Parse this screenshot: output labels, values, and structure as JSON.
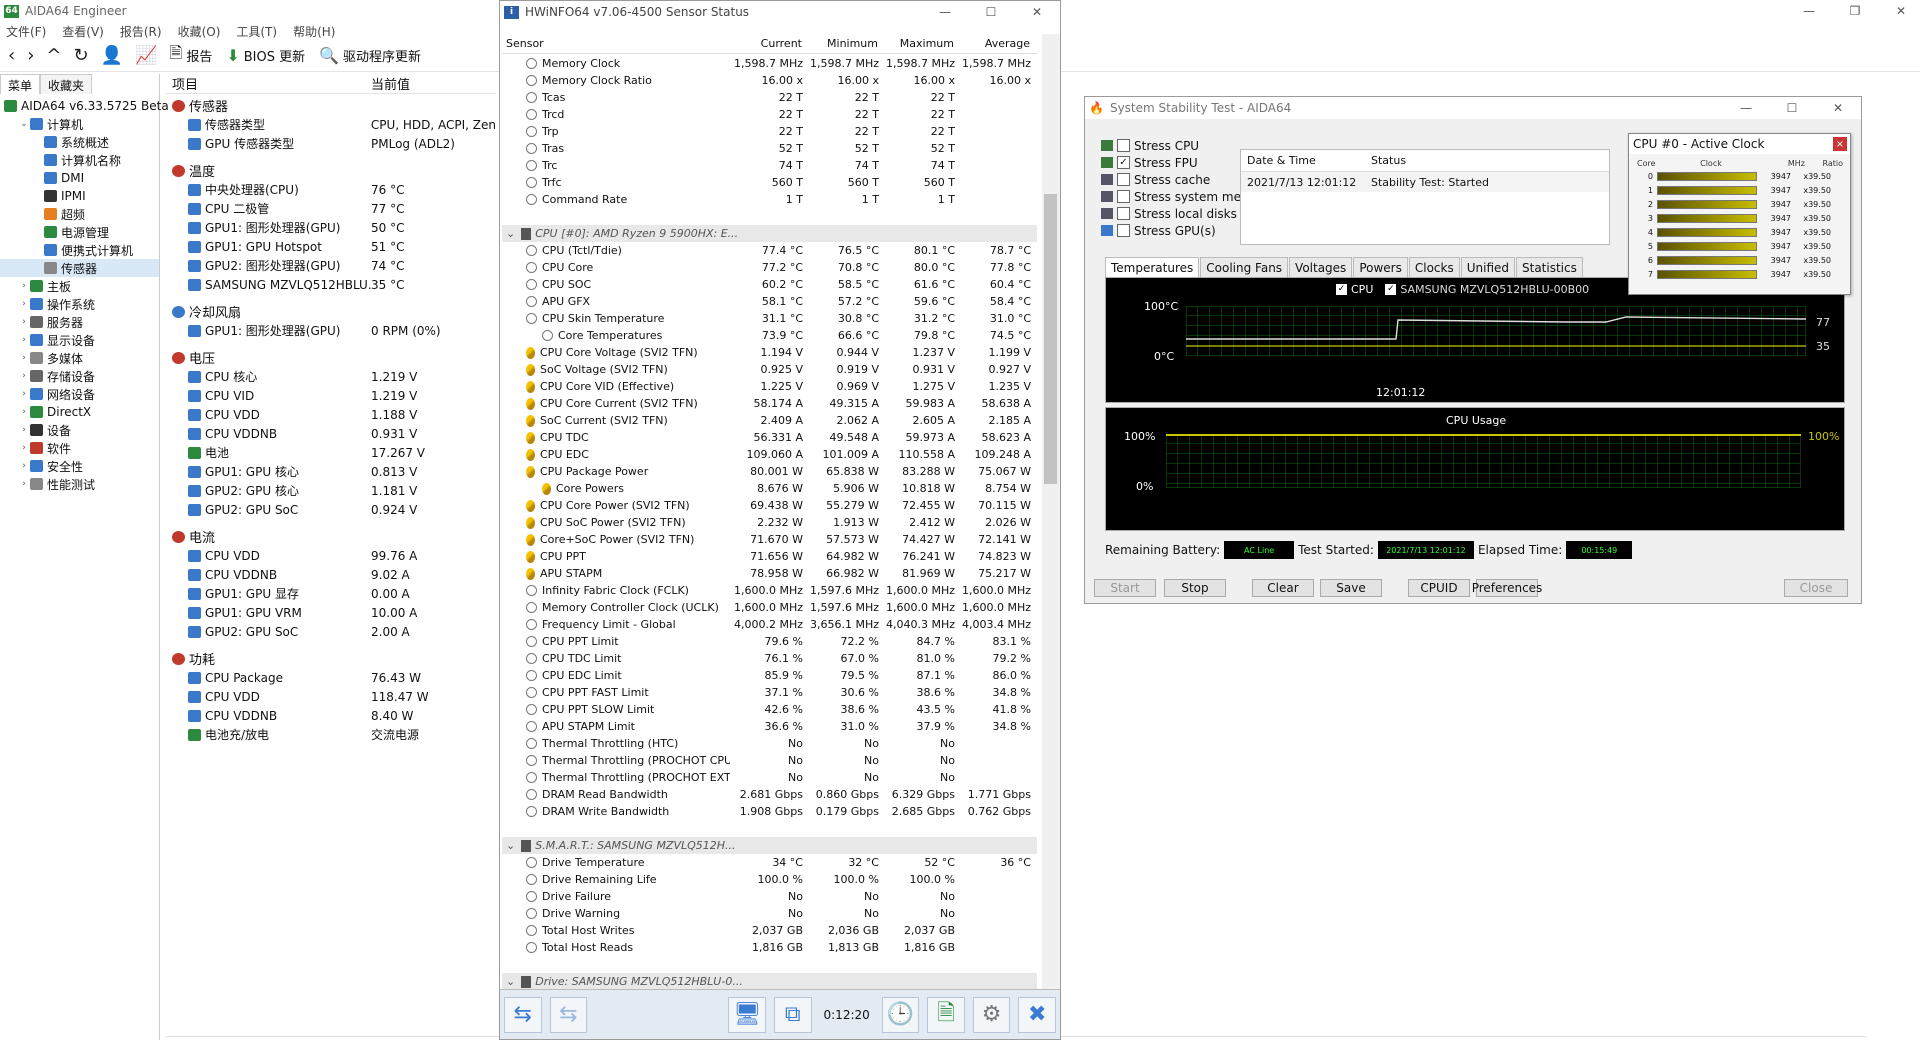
{
  "aida": {
    "title": "AIDA64 Engineer",
    "menu": [
      "文件(F)",
      "查看(V)",
      "报告(R)",
      "收藏(O)",
      "工具(T)",
      "帮助(H)"
    ],
    "toolbar": {
      "report": "报告",
      "bios": "BIOS 更新",
      "driver": "驱动程序更新"
    },
    "lefttabs": [
      "菜单",
      "收藏夹"
    ],
    "tree": [
      {
        "label": "AIDA64 v6.33.5725 Beta",
        "lvl": 0,
        "tog": "",
        "icon": "aida-icon",
        "color": "#2b8a3e"
      },
      {
        "label": "计算机",
        "lvl": 1,
        "tog": "⌄",
        "icon": "computer-icon",
        "color": "#3a78c9"
      },
      {
        "label": "系统概述",
        "lvl": 2,
        "tog": "",
        "icon": "summary-icon",
        "color": "#3a78c9"
      },
      {
        "label": "计算机名称",
        "lvl": 2,
        "tog": "",
        "icon": "name-icon",
        "color": "#3a78c9"
      },
      {
        "label": "DMI",
        "lvl": 2,
        "tog": "",
        "icon": "dmi-icon",
        "color": "#3a78c9"
      },
      {
        "label": "IPMI",
        "lvl": 2,
        "tog": "",
        "icon": "ipmi-icon",
        "color": "#333"
      },
      {
        "label": "超频",
        "lvl": 2,
        "tog": "",
        "icon": "overclock-icon",
        "color": "#e67e22"
      },
      {
        "label": "电源管理",
        "lvl": 2,
        "tog": "",
        "icon": "power-icon",
        "color": "#2b8a3e"
      },
      {
        "label": "便携式计算机",
        "lvl": 2,
        "tog": "",
        "icon": "laptop-icon",
        "color": "#3a78c9"
      },
      {
        "label": "传感器",
        "lvl": 2,
        "tog": "",
        "icon": "sensor-icon",
        "color": "#888",
        "sel": true
      },
      {
        "label": "主板",
        "lvl": 1,
        "tog": "›",
        "icon": "motherboard-icon",
        "color": "#2b8a3e"
      },
      {
        "label": "操作系统",
        "lvl": 1,
        "tog": "›",
        "icon": "os-icon",
        "color": "#3a78c9"
      },
      {
        "label": "服务器",
        "lvl": 1,
        "tog": "›",
        "icon": "server-icon",
        "color": "#666"
      },
      {
        "label": "显示设备",
        "lvl": 1,
        "tog": "›",
        "icon": "display-icon",
        "color": "#3a78c9"
      },
      {
        "label": "多媒体",
        "lvl": 1,
        "tog": "›",
        "icon": "multimedia-icon",
        "color": "#888"
      },
      {
        "label": "存储设备",
        "lvl": 1,
        "tog": "›",
        "icon": "storage-icon",
        "color": "#666"
      },
      {
        "label": "网络设备",
        "lvl": 1,
        "tog": "›",
        "icon": "network-icon",
        "color": "#3a78c9"
      },
      {
        "label": "DirectX",
        "lvl": 1,
        "tog": "›",
        "icon": "directx-icon",
        "color": "#2b8a3e"
      },
      {
        "label": "设备",
        "lvl": 1,
        "tog": "›",
        "icon": "devices-icon",
        "color": "#333"
      },
      {
        "label": "软件",
        "lvl": 1,
        "tog": "›",
        "icon": "software-icon",
        "color": "#c0392b"
      },
      {
        "label": "安全性",
        "lvl": 1,
        "tog": "›",
        "icon": "security-icon",
        "color": "#3a78c9"
      },
      {
        "label": "性能测试",
        "lvl": 1,
        "tog": "›",
        "icon": "benchmark-icon",
        "color": "#888"
      }
    ],
    "cols": [
      "项目",
      "当前值"
    ],
    "sections": [
      {
        "title": "传感器",
        "first": true,
        "rows": [
          [
            "传感器类型",
            "CPU, HDD, ACPI, Zen"
          ],
          [
            "GPU 传感器类型",
            "PMLog  (ADL2)"
          ]
        ]
      },
      {
        "title": "温度",
        "rows": [
          [
            "中央处理器(CPU)",
            "76 °C"
          ],
          [
            "CPU 二极管",
            "77 °C"
          ],
          [
            "GPU1: 图形处理器(GPU)",
            "50 °C"
          ],
          [
            "GPU1: GPU Hotspot",
            "51 °C"
          ],
          [
            "GPU2: 图形处理器(GPU)",
            "74 °C"
          ],
          [
            "SAMSUNG MZVLQ512HBLU...",
            "35 °C"
          ]
        ]
      },
      {
        "title": "冷却风扇",
        "rows": [
          [
            "GPU1: 图形处理器(GPU)",
            "0 RPM  (0%)"
          ]
        ]
      },
      {
        "title": "电压",
        "rows": [
          [
            "CPU 核心",
            "1.219 V"
          ],
          [
            "CPU VID",
            "1.219 V"
          ],
          [
            "CPU VDD",
            "1.188 V"
          ],
          [
            "CPU VDDNB",
            "0.931 V"
          ],
          [
            "电池",
            "17.267 V"
          ],
          [
            "GPU1: GPU 核心",
            "0.813 V"
          ],
          [
            "GPU2: GPU 核心",
            "1.181 V"
          ],
          [
            "GPU2: GPU SoC",
            "0.924 V"
          ]
        ]
      },
      {
        "title": "电流",
        "rows": [
          [
            "CPU VDD",
            "99.76 A"
          ],
          [
            "CPU VDDNB",
            "9.02 A"
          ],
          [
            "GPU1: GPU 显存",
            "0.00 A"
          ],
          [
            "GPU1: GPU VRM",
            "10.00 A"
          ],
          [
            "GPU2: GPU SoC",
            "2.00 A"
          ]
        ]
      },
      {
        "title": "功耗",
        "rows": [
          [
            "CPU Package",
            "76.43 W"
          ],
          [
            "CPU VDD",
            "118.47 W"
          ],
          [
            "CPU VDDNB",
            "8.40 W"
          ],
          [
            "电池充/放电",
            "交流电源"
          ]
        ]
      }
    ]
  },
  "hwinfo": {
    "title": "HWiNFO64 v7.06-4500 Sensor Status",
    "cols": [
      "Sensor",
      "Current",
      "Minimum",
      "Maximum",
      "Average"
    ],
    "time": "0:12:20",
    "rows": [
      [
        "Memory Clock",
        "1,598.7 MHz",
        "1,598.7 MHz",
        "1,598.7 MHz",
        "1,598.7 MHz"
      ],
      [
        "Memory Clock Ratio",
        "16.00 x",
        "16.00 x",
        "16.00 x",
        "16.00 x"
      ],
      [
        "Tcas",
        "22 T",
        "22 T",
        "22 T",
        ""
      ],
      [
        "Trcd",
        "22 T",
        "22 T",
        "22 T",
        ""
      ],
      [
        "Trp",
        "22 T",
        "22 T",
        "22 T",
        ""
      ],
      [
        "Tras",
        "52 T",
        "52 T",
        "52 T",
        ""
      ],
      [
        "Trc",
        "74 T",
        "74 T",
        "74 T",
        ""
      ],
      [
        "Trfc",
        "560 T",
        "560 T",
        "560 T",
        ""
      ],
      [
        "Command Rate",
        "1 T",
        "1 T",
        "1 T",
        ""
      ],
      {
        "group": "CPU [#0]: AMD Ryzen 9 5900HX: E..."
      },
      [
        "CPU (Tctl/Tdie)",
        "77.4 °C",
        "76.5 °C",
        "80.1 °C",
        "78.7 °C"
      ],
      [
        "CPU Core",
        "77.2 °C",
        "70.8 °C",
        "80.0 °C",
        "77.8 °C"
      ],
      [
        "CPU SOC",
        "60.2 °C",
        "58.5 °C",
        "61.6 °C",
        "60.4 °C"
      ],
      [
        "APU GFX",
        "58.1 °C",
        "57.2 °C",
        "59.6 °C",
        "58.4 °C"
      ],
      [
        "CPU Skin Temperature",
        "31.1 °C",
        "30.8 °C",
        "31.2 °C",
        "31.0 °C"
      ],
      [
        "Core Temperatures",
        "73.9 °C",
        "66.6 °C",
        "79.8 °C",
        "74.5 °C",
        "sub"
      ],
      [
        "CPU Core Voltage (SVI2 TFN)",
        "1.194 V",
        "0.944 V",
        "1.237 V",
        "1.199 V",
        "volt"
      ],
      [
        "SoC Voltage (SVI2 TFN)",
        "0.925 V",
        "0.919 V",
        "0.931 V",
        "0.927 V",
        "volt"
      ],
      [
        "CPU Core VID (Effective)",
        "1.225 V",
        "0.969 V",
        "1.275 V",
        "1.235 V",
        "volt"
      ],
      [
        "CPU Core Current (SVI2 TFN)",
        "58.174 A",
        "49.315 A",
        "59.983 A",
        "58.638 A",
        "volt"
      ],
      [
        "SoC Current (SVI2 TFN)",
        "2.409 A",
        "2.062 A",
        "2.605 A",
        "2.185 A",
        "volt"
      ],
      [
        "CPU TDC",
        "56.331 A",
        "49.548 A",
        "59.973 A",
        "58.623 A",
        "volt"
      ],
      [
        "CPU EDC",
        "109.060 A",
        "101.009 A",
        "110.558 A",
        "109.248 A",
        "volt"
      ],
      [
        "CPU Package Power",
        "80.001 W",
        "65.838 W",
        "83.288 W",
        "75.067 W",
        "volt"
      ],
      [
        "Core Powers",
        "8.676 W",
        "5.906 W",
        "10.818 W",
        "8.754 W",
        "subv"
      ],
      [
        "CPU Core Power (SVI2 TFN)",
        "69.438 W",
        "55.279 W",
        "72.455 W",
        "70.115 W",
        "volt"
      ],
      [
        "CPU SoC Power (SVI2 TFN)",
        "2.232 W",
        "1.913 W",
        "2.412 W",
        "2.026 W",
        "volt"
      ],
      [
        "Core+SoC Power (SVI2 TFN)",
        "71.670 W",
        "57.573 W",
        "74.427 W",
        "72.141 W",
        "volt"
      ],
      [
        "CPU PPT",
        "71.656 W",
        "64.982 W",
        "76.241 W",
        "74.823 W",
        "volt"
      ],
      [
        "APU STAPM",
        "78.958 W",
        "66.982 W",
        "81.969 W",
        "75.217 W",
        "volt"
      ],
      [
        "Infinity Fabric Clock (FCLK)",
        "1,600.0 MHz",
        "1,597.6 MHz",
        "1,600.0 MHz",
        "1,600.0 MHz"
      ],
      [
        "Memory Controller Clock (UCLK)",
        "1,600.0 MHz",
        "1,597.6 MHz",
        "1,600.0 MHz",
        "1,600.0 MHz"
      ],
      [
        "Frequency Limit - Global",
        "4,000.2 MHz",
        "3,656.1 MHz",
        "4,040.3 MHz",
        "4,003.4 MHz"
      ],
      [
        "CPU PPT Limit",
        "79.6 %",
        "72.2 %",
        "84.7 %",
        "83.1 %"
      ],
      [
        "CPU TDC Limit",
        "76.1 %",
        "67.0 %",
        "81.0 %",
        "79.2 %"
      ],
      [
        "CPU EDC Limit",
        "85.9 %",
        "79.5 %",
        "87.1 %",
        "86.0 %"
      ],
      [
        "CPU PPT FAST Limit",
        "37.1 %",
        "30.6 %",
        "38.6 %",
        "34.8 %"
      ],
      [
        "CPU PPT SLOW Limit",
        "42.6 %",
        "38.6 %",
        "43.5 %",
        "41.8 %"
      ],
      [
        "APU STAPM Limit",
        "36.6 %",
        "31.0 %",
        "37.9 %",
        "34.8 %"
      ],
      [
        "Thermal Throttling (HTC)",
        "No",
        "No",
        "No",
        ""
      ],
      [
        "Thermal Throttling (PROCHOT CPU)",
        "No",
        "No",
        "No",
        ""
      ],
      [
        "Thermal Throttling (PROCHOT EXT)",
        "No",
        "No",
        "No",
        ""
      ],
      [
        "DRAM Read Bandwidth",
        "2.681 Gbps",
        "0.860 Gbps",
        "6.329 Gbps",
        "1.771 Gbps"
      ],
      [
        "DRAM Write Bandwidth",
        "1.908 Gbps",
        "0.179 Gbps",
        "2.685 Gbps",
        "0.762 Gbps"
      ],
      {
        "group": "S.M.A.R.T.: SAMSUNG MZVLQ512H..."
      },
      [
        "Drive Temperature",
        "34 °C",
        "32 °C",
        "52 °C",
        "36 °C"
      ],
      [
        "Drive Remaining Life",
        "100.0 %",
        "100.0 %",
        "100.0 %",
        ""
      ],
      [
        "Drive Failure",
        "No",
        "No",
        "No",
        ""
      ],
      [
        "Drive Warning",
        "No",
        "No",
        "No",
        ""
      ],
      [
        "Total Host Writes",
        "2,037 GB",
        "2,036 GB",
        "2,037 GB",
        ""
      ],
      [
        "Total Host Reads",
        "1,816 GB",
        "1,813 GB",
        "1,816 GB",
        ""
      ],
      {
        "group": "Drive: SAMSUNG MZVLQ512HBLU-0..."
      }
    ]
  },
  "sst": {
    "title": "System Stability Test - AIDA64",
    "checks": [
      {
        "label": "Stress CPU",
        "checked": false
      },
      {
        "label": "Stress FPU",
        "checked": true
      },
      {
        "label": "Stress cache",
        "checked": false
      },
      {
        "label": "Stress system memory",
        "checked": false
      },
      {
        "label": "Stress local disks",
        "checked": false
      },
      {
        "label": "Stress GPU(s)",
        "checked": false
      }
    ],
    "table_head": [
      "Date & Time",
      "Status"
    ],
    "table_row": [
      "2021/7/13 12:01:12",
      "Stability Test: Started"
    ],
    "tabs": [
      "Temperatures",
      "Cooling Fans",
      "Voltages",
      "Powers",
      "Clocks",
      "Unified",
      "Statistics"
    ],
    "graph1": {
      "legend_cpu": "CPU",
      "legend_disk": "SAMSUNG MZVLQ512HBLU-00B00",
      "y_max": "100°C",
      "y_min": "0°C",
      "time": "12:01:12",
      "v1": "77",
      "v2": "35"
    },
    "graph2": {
      "title": "CPU Usage",
      "y_max": "100%",
      "y_min": "0%",
      "value": "100%"
    },
    "info": {
      "battery_label": "Remaining Battery:",
      "battery": "AC Line",
      "started_label": "Test Started:",
      "started": "2021/7/13 12:01:12",
      "elapsed_label": "Elapsed Time:",
      "elapsed": "00:15:49"
    },
    "buttons": [
      "Start",
      "Stop",
      "Clear",
      "Save",
      "CPUID",
      "Preferences",
      "Close"
    ]
  },
  "clock": {
    "title": "CPU #0 - Active Clock",
    "cols": [
      "Core",
      "Clock",
      "MHz",
      "Ratio"
    ],
    "rows": [
      [
        "0",
        "3947",
        "x39.50"
      ],
      [
        "1",
        "3947",
        "x39.50"
      ],
      [
        "2",
        "3947",
        "x39.50"
      ],
      [
        "3",
        "3947",
        "x39.50"
      ],
      [
        "4",
        "3947",
        "x39.50"
      ],
      [
        "5",
        "3947",
        "x39.50"
      ],
      [
        "6",
        "3947",
        "x39.50"
      ],
      [
        "7",
        "3947",
        "x39.50"
      ]
    ]
  }
}
